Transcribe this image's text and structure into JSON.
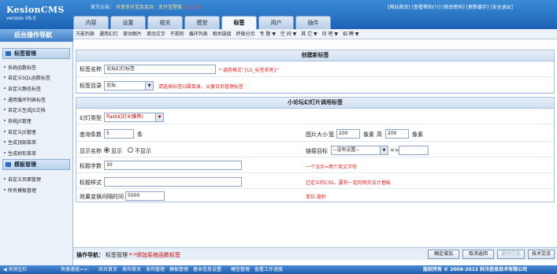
{
  "logo": {
    "title": "KesionCMS",
    "version": "version V9.0"
  },
  "header": {
    "notice_label": "官方公告：",
    "notice_link": "共享支付宝及会员：支付宝登接",
    "notice_extra": "(11-23)",
    "top_links": [
      "[网站首页]",
      "[查看帮助(?)]",
      "[修改密码]",
      "[更新缓存]",
      "[安全退出]"
    ]
  },
  "tabs": [
    {
      "label": "内容"
    },
    {
      "label": "设置"
    },
    {
      "label": "相关"
    },
    {
      "label": "模型"
    },
    {
      "label": "标签"
    },
    {
      "label": "用户"
    },
    {
      "label": "插件"
    }
  ],
  "subnav": [
    "万能列表",
    "通用幻灯",
    "滚动图片",
    "滚动文字",
    "不规则",
    "循环列表",
    "相关链接",
    "终极分页",
    "专 题 ▼",
    "空 间 ▼",
    "其 它 ▼",
    "问 吧 ▼",
    "招 聘 ▼"
  ],
  "sidebar": {
    "header": "后台操作导航",
    "group1": {
      "title": "标签管理",
      "items": [
        "系统函数标签",
        "自定义SQL函数标签",
        "自定义静态标签",
        "通用循环列表标签",
        "自定义生成JS文档",
        "系统JS管理",
        "自定义JS管理",
        "生成顶部菜单",
        "生成树形菜单"
      ]
    },
    "group2": {
      "title": "模板管理",
      "items": [
        "自定义页面管理",
        "所有模板管理"
      ]
    }
  },
  "create_panel": {
    "title": "创建新标签",
    "name_label": "标签名称",
    "name_value": "论坛幻灯标签",
    "name_hint": "* 调用格式\"{LS_标签名称}\"",
    "dir_label": "标签目录",
    "dir_value": "论坛",
    "dir_hint": "请选择标签归属目录，以便日后管理标签"
  },
  "config_panel": {
    "title": "小论坛幻灯片调用标签",
    "type_label": "幻灯类型",
    "type_value": "flash幻灯4(推荐)",
    "count_label": "查询条数",
    "count_value": "5",
    "count_unit": "条",
    "size_label": "图片大小",
    "width_label": "宽",
    "width_value": "200",
    "width_unit": "像素",
    "height_label": "高",
    "height_value": "200",
    "height_unit": "像素",
    "showname_label": "显示名称",
    "showname_yes": "显示",
    "showname_no": "不显示",
    "target_label": "链接目标",
    "target_value": "--没有设置--",
    "target_sep": "=>",
    "titlelen_label": "标题字数",
    "titlelen_value": "30",
    "titlelen_hint": "一个汉字=两个英文字符",
    "titlestyle_label": "标题样式",
    "titlestyle_hint": "已定义的CSS，要有一定的网页设计基础",
    "interval_label": "效果变换间隔时间",
    "interval_value": "5000",
    "interval_hint": "单位:毫秒"
  },
  "opbar": {
    "label": "操作导航：",
    "crumb": "标签管理",
    "arrow": ">>",
    "current": "添加系统函数标签",
    "buttons": [
      "确定增加",
      "取消返回",
      "删除信息",
      "技术交流"
    ]
  },
  "footer": {
    "left": "关闭左栏",
    "links": [
      "快速通道=>:",
      "后台首页",
      "发布首页",
      "发布管理",
      "模板管理",
      "基本信息设置",
      "模型管理",
      "查看工作进度"
    ],
    "copyright": "版权所有 © 2006-2012 科汛信息技术有限公司"
  }
}
